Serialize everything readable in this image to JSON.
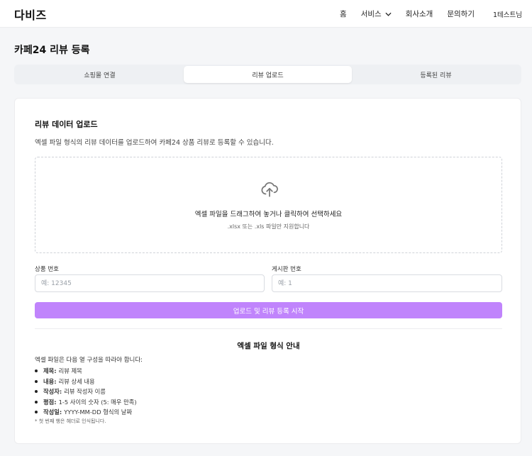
{
  "header": {
    "brand": "다비즈",
    "nav": [
      {
        "label": "홈"
      },
      {
        "label": "서비스"
      },
      {
        "label": "회사소개"
      },
      {
        "label": "문의하기"
      },
      {
        "label": "1테스트님"
      }
    ]
  },
  "page": {
    "title": "카페24 리뷰 등록"
  },
  "tabs": [
    {
      "label": "쇼핑몰 연결",
      "active": false
    },
    {
      "label": "리뷰 업로드",
      "active": true
    },
    {
      "label": "등록된 리뷰",
      "active": false
    }
  ],
  "upload": {
    "title": "리뷰 데이터 업로드",
    "description": "엑셀 파일 형식의 리뷰 데이터를 업로드하여 카페24 상품 리뷰로 등록할 수 있습니다.",
    "dropzone_main": "엑셀 파일을 드래그하여 놓거나 클릭하여 선택하세요",
    "dropzone_sub": ".xlsx 또는 .xls 파일만 지원합니다",
    "icon": "cloud-upload-icon",
    "product_label": "상품 번호",
    "product_placeholder": "예: 12345",
    "product_value": "",
    "board_label": "게시판 번호",
    "board_placeholder": "예: 1",
    "board_value": "",
    "submit_label": "업로드 및 리뷰 등록 시작"
  },
  "guide": {
    "title": "엑셀 파일 형식 안내",
    "intro": "엑셀 파일은 다음 열 구성을 따라야 합니다:",
    "items": [
      {
        "key": "제목:",
        "desc": "리뷰 제목"
      },
      {
        "key": "내용:",
        "desc": "리뷰 상세 내용"
      },
      {
        "key": "작성자:",
        "desc": "리뷰 작성자 이름"
      },
      {
        "key": "평점:",
        "desc": "1-5 사이의 숫자 (5: 매우 만족)"
      },
      {
        "key": "작성일:",
        "desc": "YYYY-MM-DD 형식의 날짜"
      }
    ],
    "note": "* 첫 번째 행은 헤더로 인식됩니다."
  },
  "colors": {
    "accent": "#c084fc",
    "background": "#f5f6f8"
  }
}
